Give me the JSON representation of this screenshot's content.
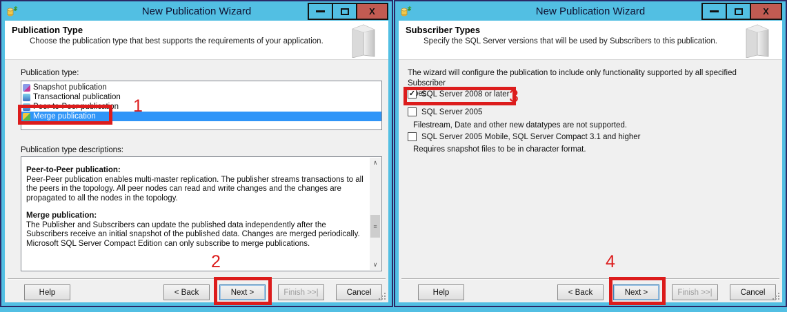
{
  "chrome": {
    "close_glyph": "X",
    "check_glyph": "✓",
    "scroll_up_glyph": "∧",
    "scroll_down_glyph": "∨",
    "scroll_grip_glyph": "≡"
  },
  "colors": {
    "titlebar": "#52BFE3",
    "close_button": "#C25B52",
    "selection_blue": "#2F95F8",
    "annotation_red": "#DC1C1C",
    "client_background": "#F0F0F0"
  },
  "windows": [
    {
      "title": "New Publication Wizard",
      "header": {
        "title": "Publication Type",
        "subtitle": "Choose the publication type that best supports the requirements of your application."
      },
      "list_label": "Publication type:",
      "list_items": [
        {
          "label": "Snapshot publication",
          "icon": "snapshot-publication-icon",
          "selected": false
        },
        {
          "label": "Transactional publication",
          "icon": "transactional-publication-icon",
          "selected": false
        },
        {
          "label": "Peer-to-Peer publication",
          "icon": "peer-to-peer-publication-icon",
          "selected": false
        },
        {
          "label": "Merge publication",
          "icon": "merge-publication-icon",
          "selected": true
        }
      ],
      "descriptions_label": "Publication type descriptions:",
      "descriptions": [
        {
          "heading": "Peer-to-Peer publication:",
          "body": "Peer-Peer publication enables multi-master replication. The publisher streams transactions to all the peers in the topology. All peer nodes can read and write changes and the changes are propagated to all the nodes in the topology."
        },
        {
          "heading": "Merge publication:",
          "body": "The Publisher and Subscribers can update the published data independently after the Subscribers receive an initial snapshot of the published data. Changes are merged periodically. Microsoft SQL Server Compact Edition can only subscribe to merge publications."
        }
      ],
      "buttons": {
        "help": "Help",
        "back": "< Back",
        "next": "Next >",
        "finish": "Finish >>|",
        "cancel": "Cancel"
      }
    },
    {
      "title": "New Publication Wizard",
      "header": {
        "title": "Subscriber Types",
        "subtitle": "Specify the SQL Server versions that will be used by Subscribers to this publication."
      },
      "intro_line1": "The wizard will configure the publication to include only functionality supported by all specified Subscriber",
      "intro_line2": "types.",
      "checkboxes": [
        {
          "label": "SQL Server 2008 or later",
          "checked": true
        },
        {
          "label": "SQL Server 2005",
          "checked": false,
          "note": "Filestream, Date and other new datatypes are not supported."
        },
        {
          "label": "SQL Server 2005 Mobile, SQL Server Compact 3.1 and higher",
          "checked": false,
          "note": "Requires snapshot files to be in character format."
        }
      ],
      "buttons": {
        "help": "Help",
        "back": "< Back",
        "next": "Next >",
        "finish": "Finish >>|",
        "cancel": "Cancel"
      }
    }
  ],
  "annotations": {
    "numbers": [
      "1",
      "2",
      "3",
      "4"
    ]
  }
}
